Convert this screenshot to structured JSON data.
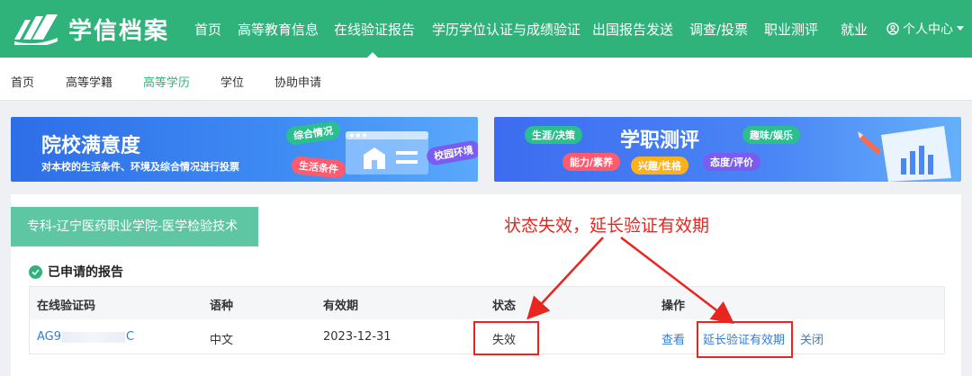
{
  "header": {
    "brand": "学信档案",
    "nav": [
      "首页",
      "高等教育信息",
      "在线验证报告",
      "学历学位认证与成绩验证",
      "出国报告发送",
      "调查/投票",
      "职业测评",
      "就业"
    ],
    "active_nav": "在线验证报告",
    "user_center": "个人中心"
  },
  "subnav": {
    "items": [
      "首页",
      "高等学籍",
      "高等学历",
      "学位",
      "协助申请"
    ],
    "active": "高等学历"
  },
  "banners": {
    "left": {
      "title": "院校满意度",
      "subtitle": "对本校的生活条件、环境及综合情况进行投票",
      "tags": [
        "综合情况",
        "生活条件",
        "校园环境"
      ]
    },
    "right": {
      "title": "学职测评",
      "tags": [
        "生涯/决策",
        "能力/素养",
        "兴趣/性格",
        "趣味/娱乐",
        "态度/评价"
      ]
    }
  },
  "main": {
    "school_tab": "专科-辽宁医药职业学院-医学检验技术",
    "annotation": "状态失效，延长验证有效期",
    "section_title": "已申请的报告",
    "table": {
      "headers": [
        "在线验证码",
        "语种",
        "有效期",
        "状态",
        "操作"
      ],
      "rows": [
        {
          "code_prefix": "AG9",
          "code_suffix": "C",
          "language": "中文",
          "expiry": "2023-12-31",
          "status": "失效",
          "actions": [
            "查看",
            "延长验证有效期",
            "关闭"
          ]
        }
      ]
    }
  },
  "colors": {
    "brand_green": "#2fb37a",
    "annotation_red": "#e9251f",
    "link_blue": "#2f7fd6"
  }
}
